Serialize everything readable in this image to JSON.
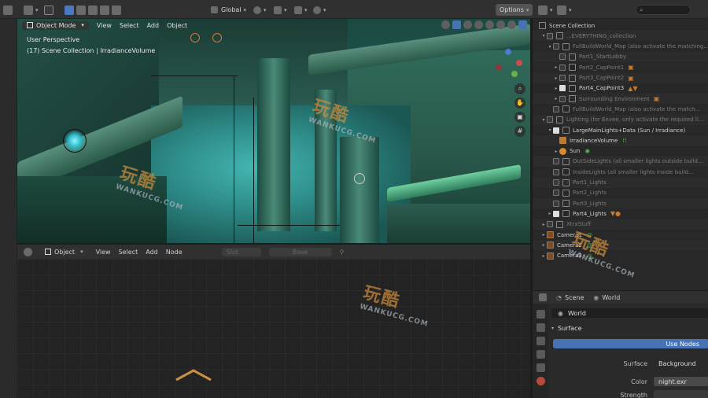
{
  "topbar": {
    "orientation": "Global",
    "options": "Options"
  },
  "viewport": {
    "mode": "Object Mode",
    "menus": [
      "View",
      "Select",
      "Add",
      "Object"
    ],
    "overlay_line1": "User Perspective",
    "overlay_line2": "(17) Scene Collection | IrradianceVolume"
  },
  "node_editor": {
    "mode": "Object",
    "menus": [
      "View",
      "Select",
      "Add",
      "Node"
    ],
    "slot": "Slot",
    "world": "Base"
  },
  "outliner": {
    "rows": [
      {
        "label": "Scene Collection",
        "dim": false,
        "check": "none",
        "twisty": "",
        "icon": "coll",
        "ext": ""
      },
      {
        "label": "...EVERYTHING_collection",
        "dim": true,
        "check": "off",
        "twisty": "▾",
        "icon": "coll",
        "ext": ""
      },
      {
        "label": "FullBuildWorld_Map (also activate the matching...",
        "dim": true,
        "check": "off",
        "twisty": "▾",
        "icon": "coll",
        "ext": ""
      },
      {
        "label": "Part1_StartLobby",
        "dim": true,
        "check": "off",
        "twisty": "",
        "icon": "coll",
        "ext": ""
      },
      {
        "label": "Part2_CapPoint1",
        "dim": true,
        "check": "off",
        "twisty": "▸",
        "icon": "coll",
        "ext": "▣"
      },
      {
        "label": "Part3_CapPoint2",
        "dim": true,
        "check": "off",
        "twisty": "▸",
        "icon": "coll",
        "ext": "▣"
      },
      {
        "label": "Part4_CapPoint3",
        "dim": false,
        "check": "on",
        "twisty": "▸",
        "icon": "coll",
        "ext": "▲▼"
      },
      {
        "label": "Surrounding Environment",
        "dim": true,
        "check": "off",
        "twisty": "▸",
        "icon": "coll",
        "ext": "▣"
      },
      {
        "label": "FullBuildWorld_Map (also activate the match...",
        "dim": true,
        "check": "off",
        "twisty": "",
        "icon": "coll",
        "ext": ""
      },
      {
        "label": "Lighting (for Eevee, only activate the required li...",
        "dim": true,
        "check": "off",
        "twisty": "▾",
        "icon": "coll",
        "ext": ""
      },
      {
        "label": "LargeMainLights+Data (Sun / Irradiance)",
        "dim": false,
        "check": "on",
        "twisty": "▾",
        "icon": "coll",
        "ext": ""
      },
      {
        "label": "IrradianceVolume",
        "dim": false,
        "check": "none",
        "twisty": "",
        "icon": "vol",
        "ext": "⁞⁞"
      },
      {
        "label": "Sun",
        "dim": false,
        "check": "none",
        "twisty": "▸",
        "icon": "lamp",
        "ext": "✺"
      },
      {
        "label": "OutSideLights (all smaller lights outside build...",
        "dim": true,
        "check": "off",
        "twisty": "",
        "icon": "coll",
        "ext": ""
      },
      {
        "label": "InsideLights (all smaller lights inside build...",
        "dim": true,
        "check": "off",
        "twisty": "",
        "icon": "coll",
        "ext": ""
      },
      {
        "label": "Part1_Lights",
        "dim": true,
        "check": "off",
        "twisty": "",
        "icon": "coll",
        "ext": ""
      },
      {
        "label": "Part2_Lights",
        "dim": true,
        "check": "off",
        "twisty": "",
        "icon": "coll",
        "ext": ""
      },
      {
        "label": "Part3_Lights",
        "dim": true,
        "check": "off",
        "twisty": "",
        "icon": "coll",
        "ext": ""
      },
      {
        "label": "Part4_Lights",
        "dim": false,
        "check": "on",
        "twisty": "▸",
        "icon": "coll",
        "ext": "▼●"
      },
      {
        "label": "XtraStuff",
        "dim": true,
        "check": "off",
        "twisty": "▸",
        "icon": "coll",
        "ext": ""
      },
      {
        "label": "Camera1",
        "dim": false,
        "check": "none",
        "twisty": "▸",
        "icon": "cam",
        "ext": "◎"
      },
      {
        "label": "Camera2",
        "dim": false,
        "check": "none",
        "twisty": "▸",
        "icon": "cam",
        "ext": "◎"
      },
      {
        "label": "Camera3",
        "dim": false,
        "check": "none",
        "twisty": "▸",
        "icon": "cam",
        "ext": "◎"
      }
    ]
  },
  "properties": {
    "tab_scene": "Scene",
    "tab_world": "World",
    "world_name": "World",
    "section": "Surface",
    "use_nodes": "Use Nodes",
    "surface_label": "Surface",
    "surface_value": "Background",
    "color_label": "Color",
    "color_value": "night.exr",
    "strength_label": "Strength"
  },
  "watermark": {
    "text": "玩酷",
    "sub": "WANKUCG.COM"
  },
  "colors": {
    "accent": "#4772b3",
    "collection_icon": "#c67a2e",
    "object_data": "#58b35a"
  }
}
